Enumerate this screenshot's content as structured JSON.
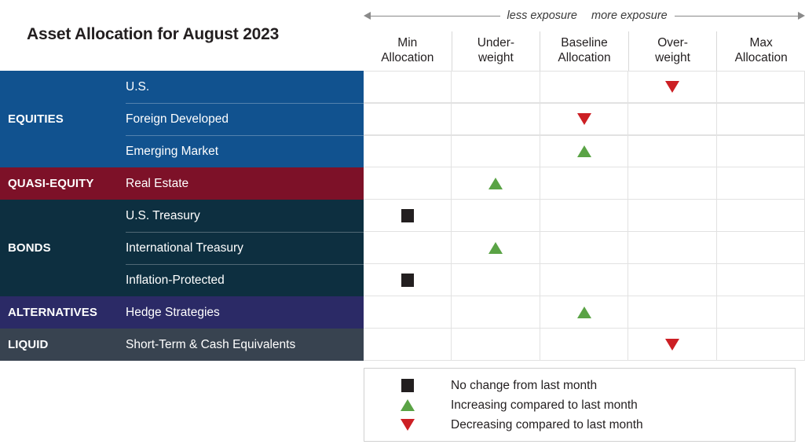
{
  "title": "Asset Allocation for August 2023",
  "exposure_axis": {
    "less_label": "less exposure",
    "more_label": "more exposure"
  },
  "columns": [
    {
      "line1": "Min",
      "line2": "Allocation"
    },
    {
      "line1": "Under-",
      "line2": "weight"
    },
    {
      "line1": "Baseline",
      "line2": "Allocation"
    },
    {
      "line1": "Over-",
      "line2": "weight"
    },
    {
      "line1": "Max",
      "line2": "Allocation"
    }
  ],
  "colors": {
    "equities": "#11528f",
    "quasi_equity": "#7d1128",
    "bonds": "#0d2f40",
    "alternatives": "#2b2a66",
    "liquid": "#384350",
    "increase": "#5aa345",
    "decrease": "#cc1f24",
    "no_change": "#231f20"
  },
  "groups": [
    {
      "name": "EQUITIES",
      "color_key": "equities",
      "rows": [
        {
          "label": "U.S.",
          "column": 3,
          "marker": "decrease"
        },
        {
          "label": "Foreign Developed",
          "column": 2,
          "marker": "decrease"
        },
        {
          "label": "Emerging Market",
          "column": 2,
          "marker": "increase"
        }
      ]
    },
    {
      "name": "QUASI-EQUITY",
      "color_key": "quasi_equity",
      "rows": [
        {
          "label": "Real Estate",
          "column": 1,
          "marker": "increase"
        }
      ]
    },
    {
      "name": "BONDS",
      "color_key": "bonds",
      "rows": [
        {
          "label": "U.S. Treasury",
          "column": 0,
          "marker": "no_change"
        },
        {
          "label": "International Treasury",
          "column": 1,
          "marker": "increase"
        },
        {
          "label": "Inflation-Protected",
          "column": 0,
          "marker": "no_change"
        }
      ]
    },
    {
      "name": "ALTERNATIVES",
      "color_key": "alternatives",
      "rows": [
        {
          "label": "Hedge Strategies",
          "column": 2,
          "marker": "increase"
        }
      ]
    },
    {
      "name": "LIQUID",
      "color_key": "liquid",
      "rows": [
        {
          "label": "Short-Term & Cash Equivalents",
          "column": 3,
          "marker": "decrease"
        }
      ]
    }
  ],
  "legend": [
    {
      "marker": "no_change",
      "text": "No change from last month"
    },
    {
      "marker": "increase",
      "text": "Increasing compared to last month"
    },
    {
      "marker": "decrease",
      "text": "Decreasing compared to last month"
    }
  ],
  "chart_data": {
    "type": "table",
    "title": "Asset Allocation for August 2023",
    "categories": [
      "Min Allocation",
      "Under-weight",
      "Baseline Allocation",
      "Over-weight",
      "Max Allocation"
    ],
    "xlabel": "less exposure ↔ more exposure",
    "ylabel": "",
    "grid": true,
    "legend_position": "bottom-right",
    "series": [
      {
        "name": "U.S.",
        "group": "EQUITIES",
        "position": "Over-weight",
        "change": "decreasing"
      },
      {
        "name": "Foreign Developed",
        "group": "EQUITIES",
        "position": "Baseline Allocation",
        "change": "decreasing"
      },
      {
        "name": "Emerging Market",
        "group": "EQUITIES",
        "position": "Baseline Allocation",
        "change": "increasing"
      },
      {
        "name": "Real Estate",
        "group": "QUASI-EQUITY",
        "position": "Under-weight",
        "change": "increasing"
      },
      {
        "name": "U.S. Treasury",
        "group": "BONDS",
        "position": "Min Allocation",
        "change": "no change"
      },
      {
        "name": "International Treasury",
        "group": "BONDS",
        "position": "Under-weight",
        "change": "increasing"
      },
      {
        "name": "Inflation-Protected",
        "group": "BONDS",
        "position": "Min Allocation",
        "change": "no change"
      },
      {
        "name": "Hedge Strategies",
        "group": "ALTERNATIVES",
        "position": "Baseline Allocation",
        "change": "increasing"
      },
      {
        "name": "Short-Term & Cash Equivalents",
        "group": "LIQUID",
        "position": "Over-weight",
        "change": "decreasing"
      }
    ]
  }
}
